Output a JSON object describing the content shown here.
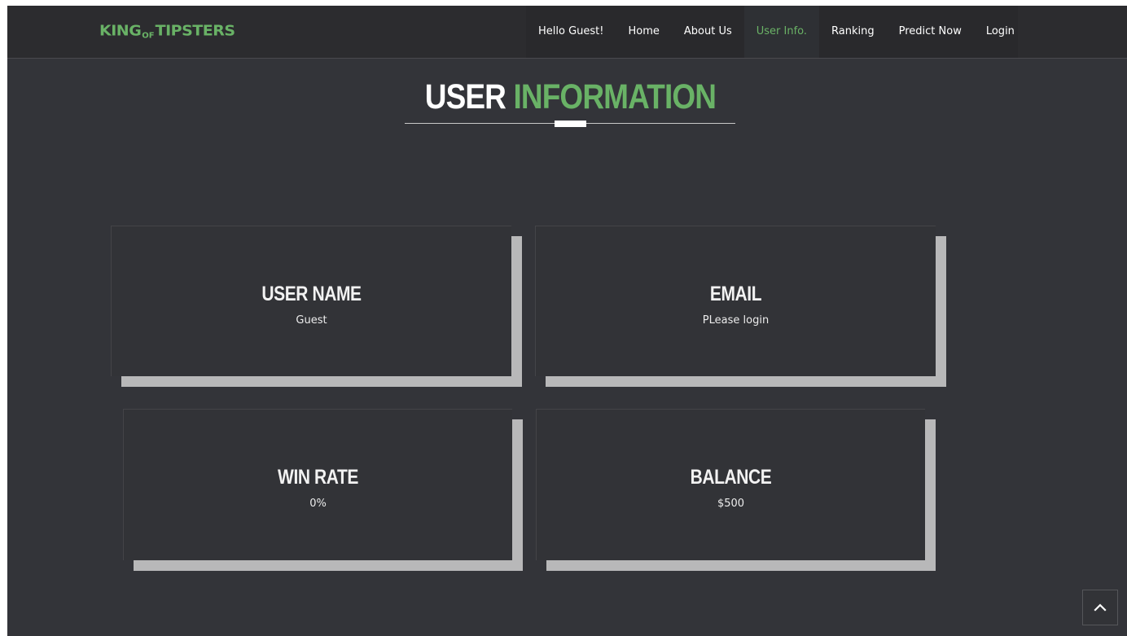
{
  "brand": {
    "logo_part1": "KING",
    "logo_part2": "OF",
    "logo_part3": "TIPSTERS"
  },
  "nav": {
    "greeting": "Hello Guest!",
    "home": "Home",
    "about": "About Us",
    "user_info": "User Info.",
    "ranking": "Ranking",
    "predict": "Predict Now",
    "login": "Login"
  },
  "page": {
    "title_white": "USER",
    "title_green": "INFORMATION"
  },
  "cards": {
    "username": {
      "label": "USER NAME",
      "value": "Guest"
    },
    "email": {
      "label": "EMAIL",
      "value": "PLease login"
    },
    "winrate": {
      "label": "WIN RATE",
      "value": "0%"
    },
    "balance": {
      "label": "BALANCE",
      "value": "$500"
    }
  },
  "icons": {
    "scroll_top": "chevron-up-icon"
  },
  "colors": {
    "accent": "#69b266",
    "background": "#333439",
    "card_shadow": "#b8b8b9"
  }
}
